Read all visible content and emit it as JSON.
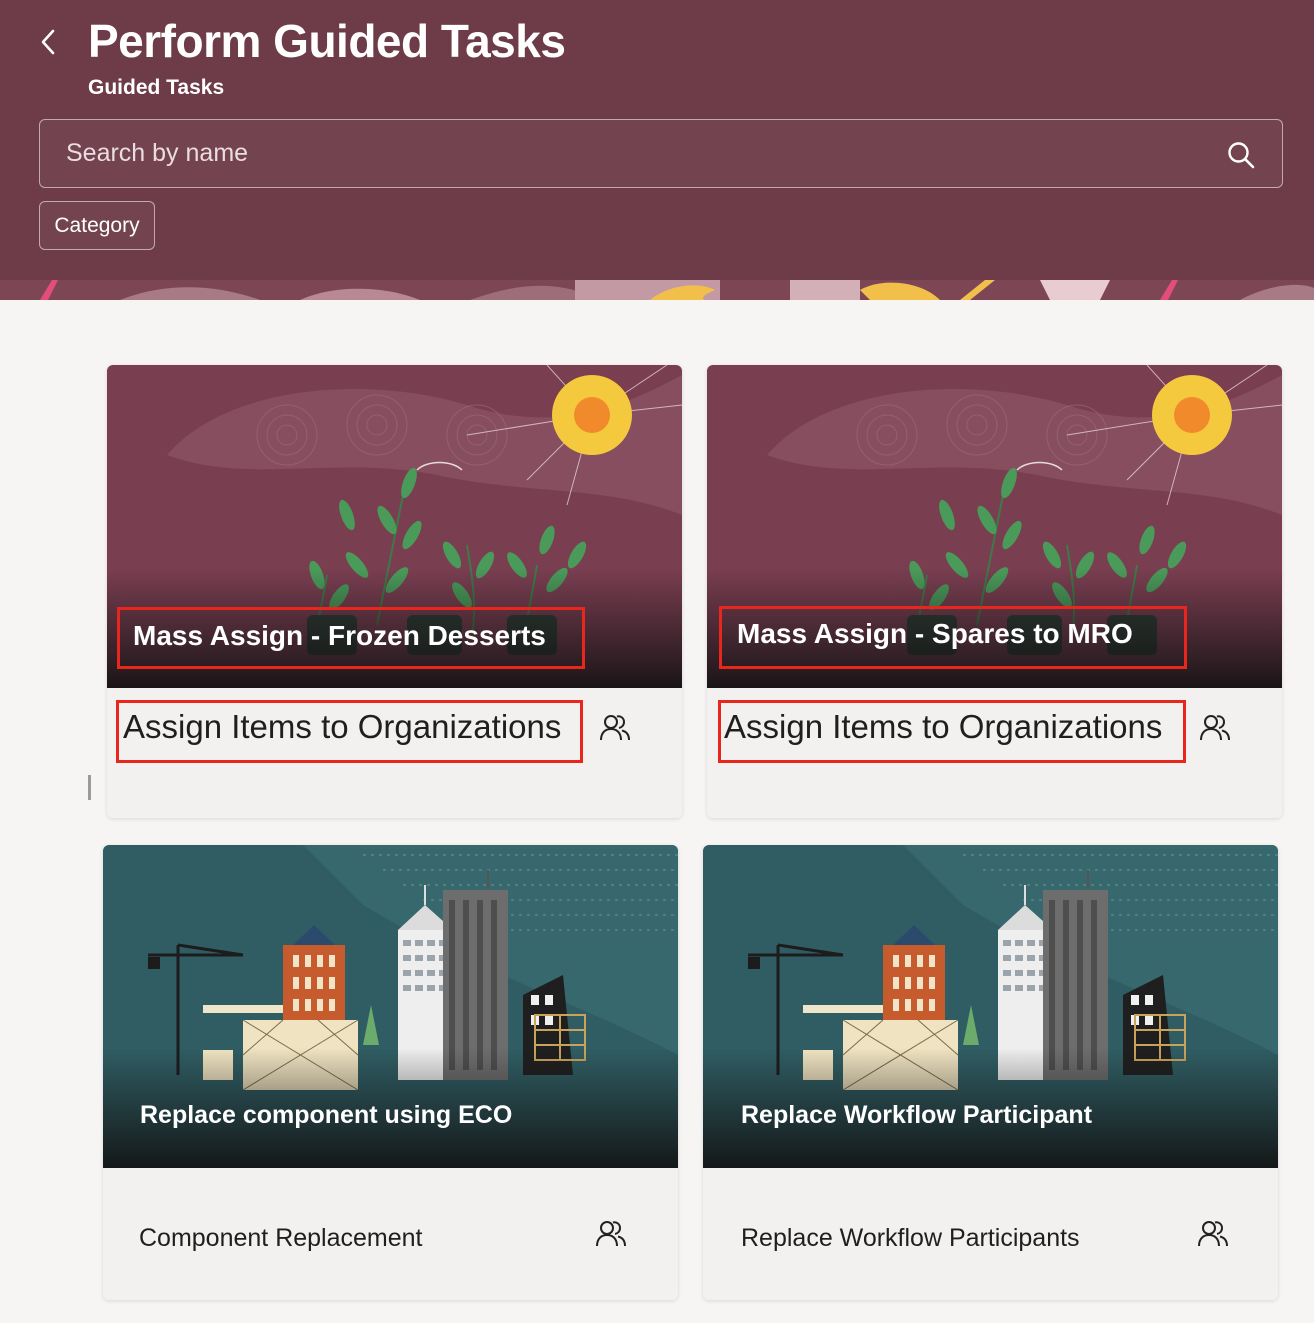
{
  "header": {
    "title": "Perform Guided Tasks",
    "subtitle": "Guided Tasks",
    "back_icon": "chevron-left-icon",
    "search_placeholder": "Search by name",
    "search_icon": "search-icon",
    "category_label": "Category",
    "background_color": "#6e3c49"
  },
  "cards": [
    {
      "title": "Mass Assign - Frozen Desserts",
      "subtitle": "Assign Items to Organizations",
      "icon": "people-icon",
      "theme": "plants"
    },
    {
      "title": "Mass Assign - Spares to MRO",
      "subtitle": "Assign Items to Organizations",
      "icon": "people-icon",
      "theme": "plants"
    },
    {
      "title": "Replace component using ECO",
      "subtitle": "Component Replacement",
      "icon": "people-icon",
      "theme": "city"
    },
    {
      "title": "Replace Workflow Participant",
      "subtitle": "Replace Workflow Participants",
      "icon": "people-icon",
      "theme": "city"
    }
  ],
  "highlight_color": "#e8261c"
}
